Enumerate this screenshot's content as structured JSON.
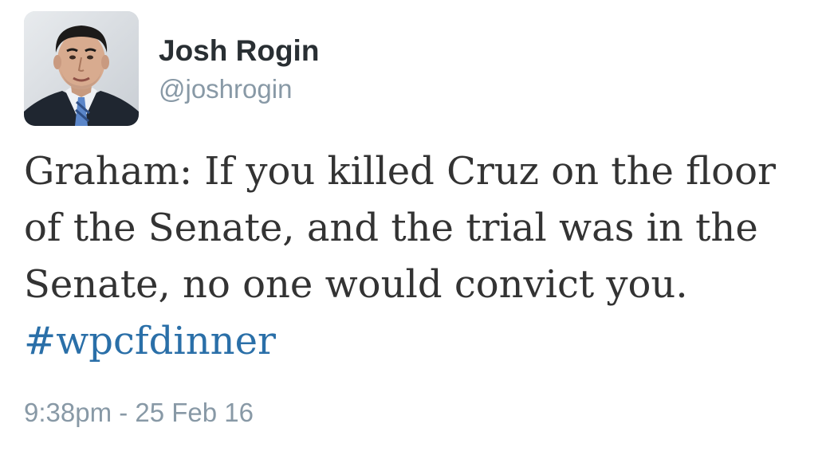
{
  "author": {
    "display_name": "Josh Rogin",
    "handle": "@joshrogin",
    "avatar_icon": "profile-photo"
  },
  "tweet": {
    "text_lines": [
      "Graham: If you killed Cruz on the floor",
      "of the Senate, and the trial was in the",
      "Senate, no one would convict you."
    ],
    "hashtag": "#wpcfdinner",
    "timestamp": "9:38pm - 25 Feb 16"
  },
  "colors": {
    "name": "#292f33",
    "secondary": "#8899a6",
    "body_text": "#333333",
    "hashtag": "#2a6fa8",
    "background": "#ffffff"
  }
}
